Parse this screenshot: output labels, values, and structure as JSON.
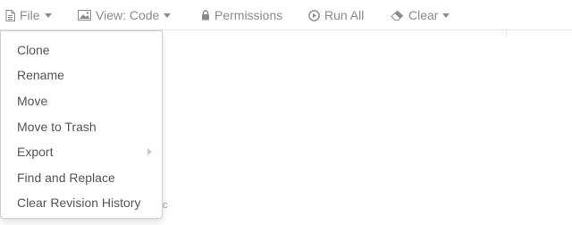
{
  "toolbar": {
    "file_label": "File",
    "view_label": "View: Code",
    "permissions_label": "Permissions",
    "run_all_label": "Run All",
    "clear_label": "Clear"
  },
  "file_menu": {
    "items": [
      {
        "label": "Clone"
      },
      {
        "label": "Rename"
      },
      {
        "label": "Move"
      },
      {
        "label": "Move to Trash"
      },
      {
        "label": "Export",
        "has_submenu": true
      },
      {
        "label": "Find and Replace"
      },
      {
        "label": "Clear Revision History"
      }
    ]
  },
  "behind_menu_glyph": "c",
  "colors": {
    "toolbar_text": "#8a8a8a",
    "menu_text": "#555555",
    "border": "#cfcfcf",
    "divider": "#e2e2e2"
  },
  "icons": [
    "document-icon",
    "image-icon",
    "lock-icon",
    "play-circle-icon",
    "eraser-icon",
    "chevron-down-icon",
    "chevron-right-icon"
  ]
}
